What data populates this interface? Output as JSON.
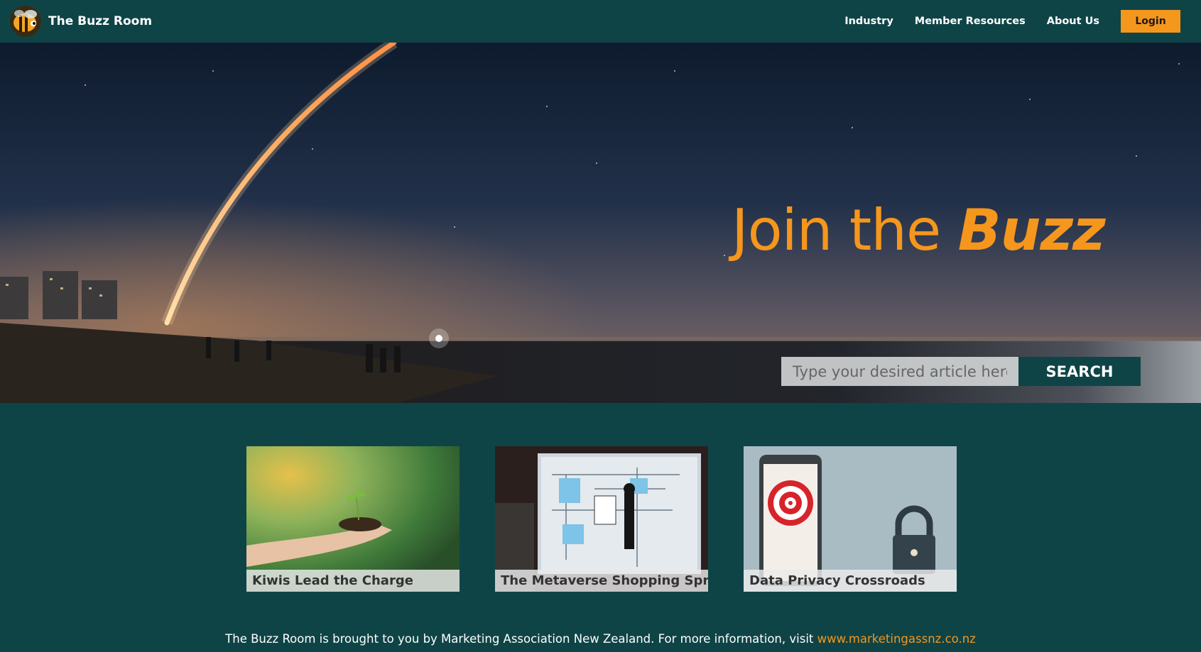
{
  "nav": {
    "brand": "The Buzz Room",
    "links": [
      "Industry",
      "Member Resources",
      "About Us"
    ],
    "login": "Login"
  },
  "hero": {
    "title_regular": "Join the ",
    "title_emphasis": "Buzz",
    "search_placeholder": "Type your desired article here",
    "search_button": "SEARCH"
  },
  "cards": [
    {
      "title": "Kiwis Lead the Charge"
    },
    {
      "title": "The Metaverse Shopping Spree"
    },
    {
      "title": "Data Privacy Crossroads"
    }
  ],
  "footer": {
    "text": "The Buzz Room is brought to you by Marketing Association New Zealand. For more information, visit ",
    "link": "www.marketingassnz.co.nz"
  },
  "colors": {
    "brand_dark_teal": "#0f4447",
    "accent_orange": "#f5961d"
  },
  "icons": {
    "logo": "bee-logo-icon"
  }
}
